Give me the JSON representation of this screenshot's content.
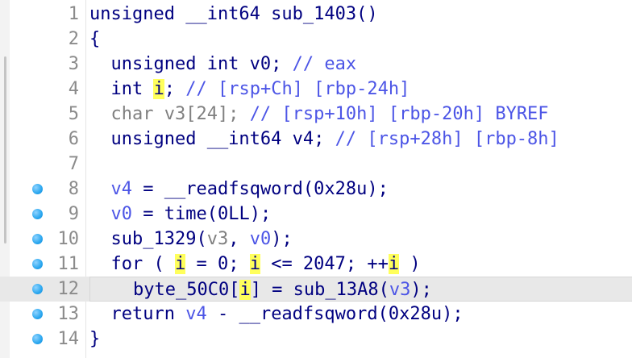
{
  "editor": {
    "lines": [
      {
        "num": "1",
        "breakpoint": false,
        "current": false,
        "segs": [
          {
            "t": "unsigned __int64 sub_1403()",
            "c": ""
          }
        ]
      },
      {
        "num": "2",
        "breakpoint": false,
        "current": false,
        "segs": [
          {
            "t": "{",
            "c": ""
          }
        ]
      },
      {
        "num": "3",
        "breakpoint": false,
        "current": false,
        "segs": [
          {
            "t": "  unsigned int v0; ",
            "c": ""
          },
          {
            "t": "// eax",
            "c": "cmt"
          }
        ]
      },
      {
        "num": "4",
        "breakpoint": false,
        "current": false,
        "segs": [
          {
            "t": "  int ",
            "c": ""
          },
          {
            "t": "i",
            "c": "hl"
          },
          {
            "t": "; ",
            "c": ""
          },
          {
            "t": "// [rsp+Ch] [rbp-24h]",
            "c": "cmt"
          }
        ]
      },
      {
        "num": "5",
        "breakpoint": false,
        "current": false,
        "segs": [
          {
            "t": "  char v3[24]; ",
            "c": "gray"
          },
          {
            "t": "// [rsp+10h] [rbp-20h] BYREF",
            "c": "cmt"
          }
        ]
      },
      {
        "num": "6",
        "breakpoint": false,
        "current": false,
        "segs": [
          {
            "t": "  unsigned __int64 v4; ",
            "c": ""
          },
          {
            "t": "// [rsp+28h] [rbp-8h]",
            "c": "cmt"
          }
        ]
      },
      {
        "num": "7",
        "breakpoint": false,
        "current": false,
        "segs": [
          {
            "t": "",
            "c": ""
          }
        ]
      },
      {
        "num": "8",
        "breakpoint": true,
        "current": false,
        "segs": [
          {
            "t": "  ",
            "c": ""
          },
          {
            "t": "v4",
            "c": "cmt"
          },
          {
            "t": " = __readfsqword(0x28u);",
            "c": ""
          }
        ]
      },
      {
        "num": "9",
        "breakpoint": true,
        "current": false,
        "segs": [
          {
            "t": "  ",
            "c": ""
          },
          {
            "t": "v0",
            "c": "cmt"
          },
          {
            "t": " = time(0LL);",
            "c": ""
          }
        ]
      },
      {
        "num": "10",
        "breakpoint": true,
        "current": false,
        "segs": [
          {
            "t": "  sub_1329(",
            "c": ""
          },
          {
            "t": "v3",
            "c": "gray"
          },
          {
            "t": ", ",
            "c": ""
          },
          {
            "t": "v0",
            "c": "cmt"
          },
          {
            "t": ");",
            "c": ""
          }
        ]
      },
      {
        "num": "11",
        "breakpoint": true,
        "current": false,
        "segs": [
          {
            "t": "  for ( ",
            "c": ""
          },
          {
            "t": "i",
            "c": "hl"
          },
          {
            "t": " = 0; ",
            "c": ""
          },
          {
            "t": "i",
            "c": "hl"
          },
          {
            "t": " <= 2047; ++",
            "c": ""
          },
          {
            "t": "i",
            "c": "hl"
          },
          {
            "t": " )",
            "c": ""
          }
        ]
      },
      {
        "num": "12",
        "breakpoint": true,
        "current": true,
        "segs": [
          {
            "t": "    byte_50C0[",
            "c": ""
          },
          {
            "t": "i",
            "c": "hl"
          },
          {
            "t": "] = sub_13A8(",
            "c": ""
          },
          {
            "t": "v3",
            "c": "cmt"
          },
          {
            "t": ");",
            "c": ""
          }
        ]
      },
      {
        "num": "13",
        "breakpoint": true,
        "current": false,
        "segs": [
          {
            "t": "  return ",
            "c": ""
          },
          {
            "t": "v4",
            "c": "cmt"
          },
          {
            "t": " - __readfsqword(0x28u);",
            "c": ""
          }
        ]
      },
      {
        "num": "14",
        "breakpoint": true,
        "current": false,
        "segs": [
          {
            "t": "}",
            "c": ""
          }
        ]
      }
    ]
  }
}
